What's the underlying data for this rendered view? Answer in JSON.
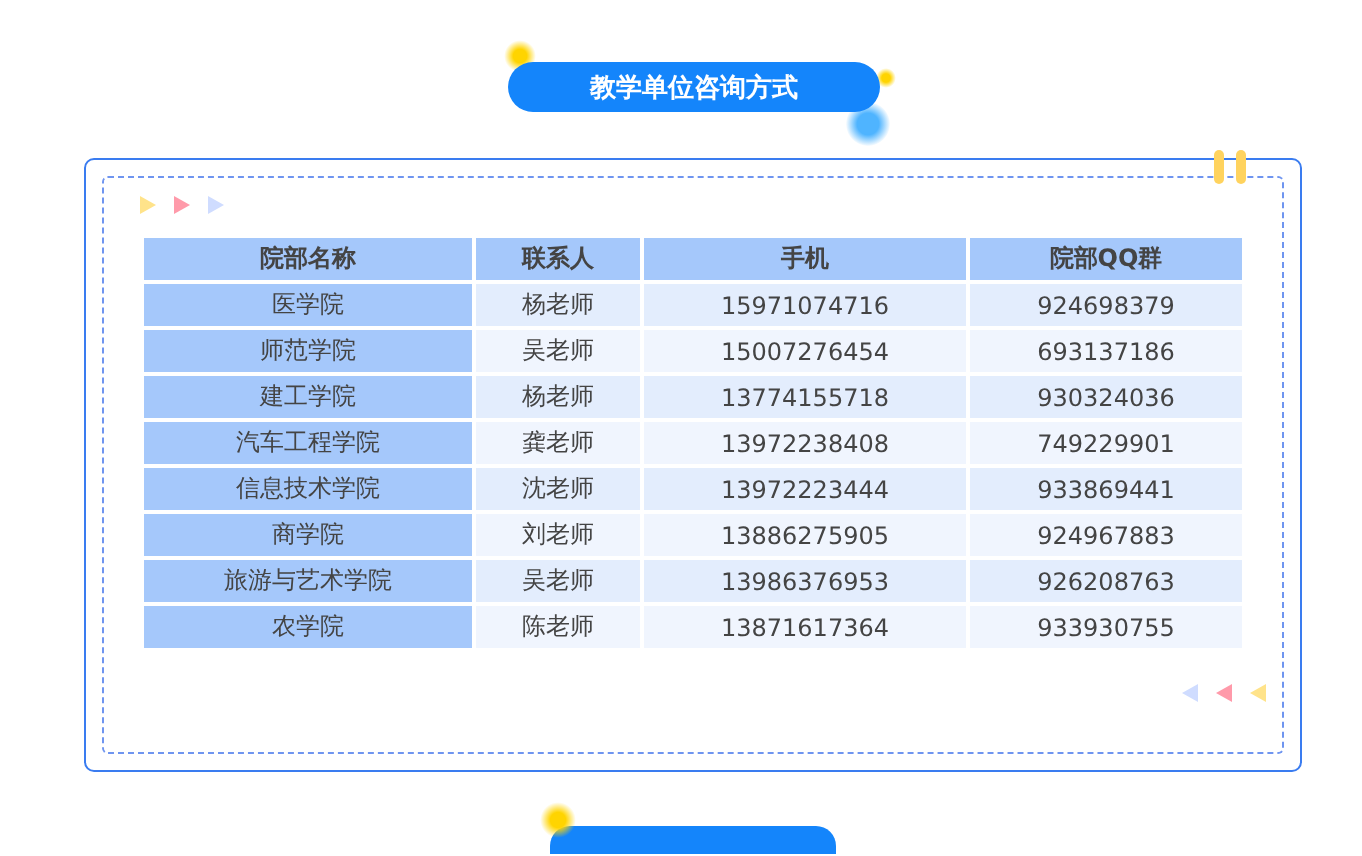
{
  "title": "教学单位咨询方式",
  "table": {
    "columns": [
      "院部名称",
      "联系人",
      "手机",
      "院部QQ群"
    ],
    "rows": [
      [
        "医学院",
        "杨老师",
        "15971074716",
        "924698379"
      ],
      [
        "师范学院",
        "吴老师",
        "15007276454",
        "693137186"
      ],
      [
        "建工学院",
        "杨老师",
        "13774155718",
        "930324036"
      ],
      [
        "汽车工程学院",
        "龚老师",
        "13972238408",
        "749229901"
      ],
      [
        "信息技术学院",
        "沈老师",
        "13972223444",
        "933869441"
      ],
      [
        "商学院",
        "刘老师",
        "13886275905",
        "924967883"
      ],
      [
        "旅游与艺术学院",
        "吴老师",
        "13986376953",
        "926208763"
      ],
      [
        "农学院",
        "陈老师",
        "13871617364",
        "933930755"
      ]
    ]
  }
}
